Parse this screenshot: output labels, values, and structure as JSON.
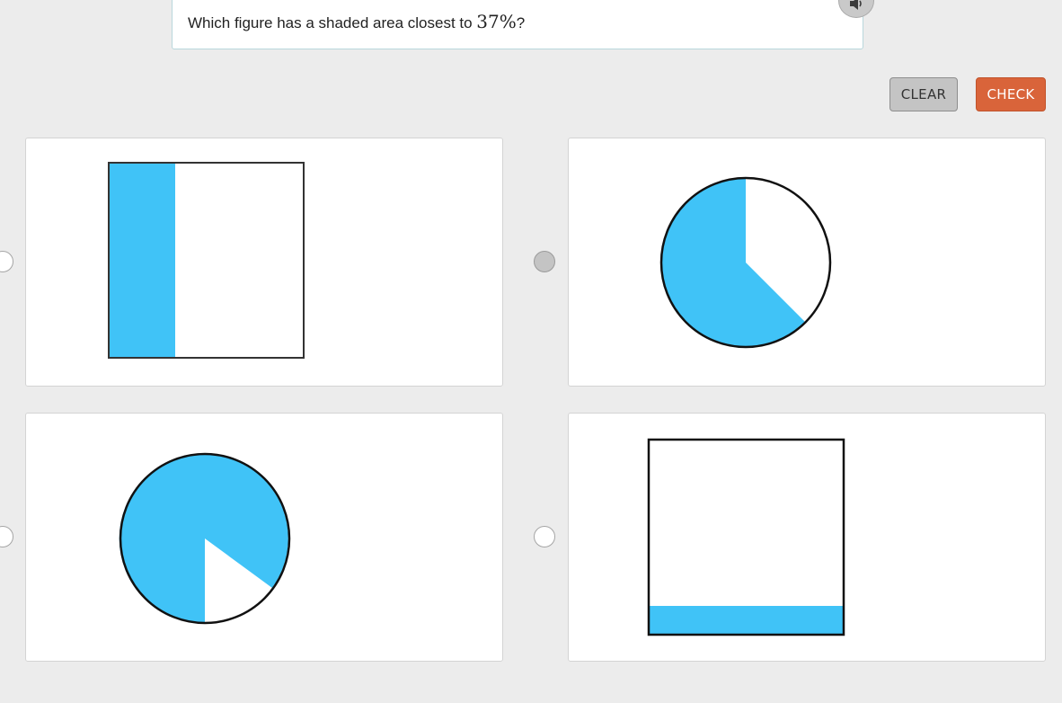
{
  "question": {
    "prefix": "Which figure has a shaded area closest to ",
    "math": "37%",
    "suffix": "?"
  },
  "buttons": {
    "clear_label": "CLEAR",
    "check_label": "CHECK"
  },
  "colors": {
    "shade": "#40c3f7",
    "check_button": "#d9643a",
    "clear_button": "#c4c4c4"
  },
  "icons": {
    "audio": "speaker-icon"
  },
  "choices": [
    {
      "shape": "square",
      "shading": "left vertical strip",
      "shaded_fraction": 0.34,
      "selected": false
    },
    {
      "shape": "circle",
      "shading": "sector",
      "shaded_fraction": 0.64,
      "selected": true
    },
    {
      "shape": "circle",
      "shading": "sector",
      "shaded_fraction": 0.83,
      "selected": false
    },
    {
      "shape": "square",
      "shading": "bottom horizontal strip",
      "shaded_fraction": 0.15,
      "selected": false
    }
  ]
}
